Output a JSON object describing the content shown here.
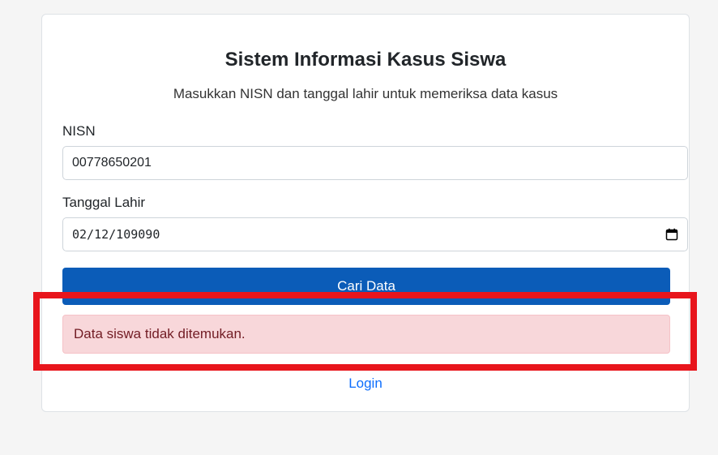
{
  "form": {
    "title": "Sistem Informasi Kasus Siswa",
    "subtitle": "Masukkan NISN dan tanggal lahir untuk memeriksa data kasus",
    "nisn_label": "NISN",
    "nisn_value": "00778650201",
    "tgl_label": "Tanggal Lahir",
    "tgl_value": "02/12/109090",
    "submit_label": "Cari Data",
    "error_message": "Data siswa tidak ditemukan.",
    "login_link": "Login"
  },
  "colors": {
    "primary_button": "#0b5cb8",
    "alert_bg": "#f8d7da",
    "alert_text": "#721c24",
    "link": "#0d6efd",
    "highlight": "#e8151c"
  },
  "icons": {
    "date_picker": "calendar-icon"
  }
}
